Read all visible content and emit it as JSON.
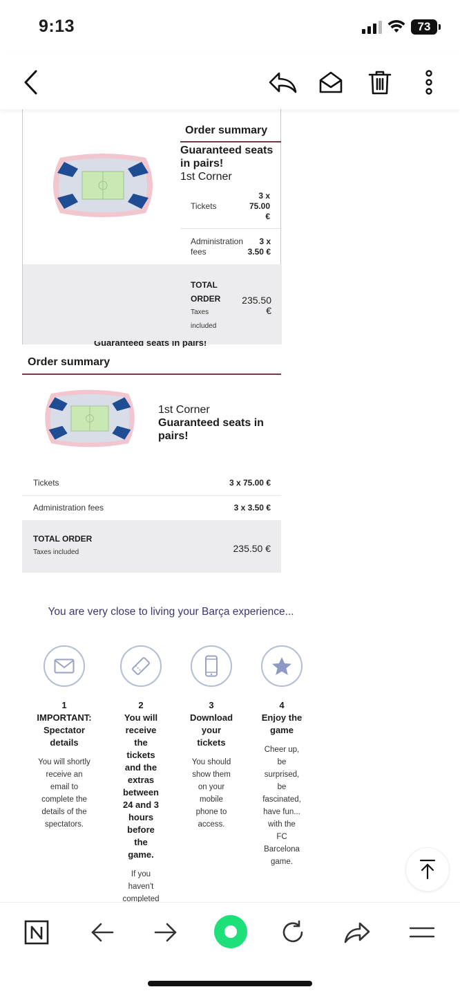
{
  "status_bar": {
    "time": "9:13",
    "battery": "73"
  },
  "card1": {
    "title": "Order summary",
    "product_name": "Guaranteed seats in pairs!",
    "sector": "1st Corner",
    "tickets_label": "Tickets",
    "tickets_value_lines": [
      "3 x",
      "75.00",
      "€"
    ],
    "fees_label_lines": [
      "Administration",
      "fees"
    ],
    "fees_value_lines": [
      "3 x",
      "3.50 €"
    ],
    "total_label_lines": [
      "TOTAL",
      "ORDER"
    ],
    "taxes_lines": [
      "Taxes",
      "included"
    ],
    "total_value_lines": [
      "235.50",
      "€"
    ]
  },
  "clipped_heading": "Guaranteed seats in pairs!",
  "card2": {
    "title": "Order summary",
    "sector": "1st Corner",
    "product_name": "Guaranteed seats in pairs!",
    "rows": [
      {
        "label": "Tickets",
        "value": "3 x 75.00 €"
      },
      {
        "label": "Administration fees",
        "value": "3 x 3.50 €"
      }
    ],
    "total_label": "TOTAL ORDER",
    "taxes": "Taxes included",
    "total_value": "235.50 €"
  },
  "experience": "You are very close to living your Barça experience...",
  "steps": [
    {
      "num": "1",
      "icon": "envelope-icon",
      "title_lines": [
        "IMPORTANT:",
        "Spectator",
        "details"
      ],
      "text_lines": [
        "You will shortly",
        "receive an",
        "email to",
        "complete the",
        "details of the",
        "spectators."
      ]
    },
    {
      "num": "2",
      "icon": "ticket-icon",
      "title_lines": [
        "You will",
        "receive",
        "the",
        "tickets",
        "and the",
        "extras",
        "between",
        "24 and 3",
        "hours",
        "before",
        "the",
        "game."
      ],
      "text_lines": [
        "If you",
        "haven't",
        "completed"
      ]
    },
    {
      "num": "3",
      "icon": "mobile-phone-icon",
      "title_lines": [
        "Download",
        "your",
        "tickets"
      ],
      "text_lines": [
        "You should",
        "show them",
        "on your",
        "mobile",
        "phone to",
        "access."
      ]
    },
    {
      "num": "4",
      "icon": "star-icon",
      "title_lines": [
        "Enjoy the",
        "game"
      ],
      "text_lines": [
        "Cheer up,",
        "be",
        "surprised,",
        "be",
        "fascinated,",
        "have fun...",
        "with the",
        "FC",
        "Barcelona",
        "game."
      ]
    }
  ],
  "colors": {
    "accent_purple": "#3d3570",
    "summary_rule": "#6b3a4c",
    "total_band": "#ececee",
    "brave_green": "#1ee07a"
  }
}
